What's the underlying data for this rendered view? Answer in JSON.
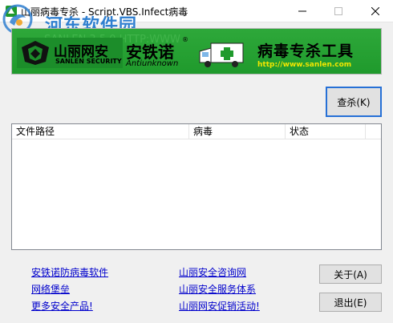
{
  "window": {
    "title": "山丽病毒专杀 - Script.VBS.Infect病毒"
  },
  "watermark": {
    "text": "河东软件园"
  },
  "banner": {
    "ghost_text": "SANLEN 3.5.0 HTTP:WWW",
    "brand_cn": "山丽网安",
    "brand_en": "SANLEN SECURITY",
    "product_cn": "安铁诺",
    "product_reg": "®",
    "product_en": "Antiunknown",
    "tool_cn": "病毒专杀工具",
    "tool_url": "http://www.sanlen.com"
  },
  "buttons": {
    "scan": "查杀(K)",
    "about": "关于(A)",
    "exit": "退出(E)"
  },
  "list": {
    "columns": [
      "文件路径",
      "病毒",
      "状态"
    ],
    "rows": []
  },
  "links": {
    "antivirus_software": "安铁诺防病毒软件",
    "network_fortress": "网络堡垒",
    "more_products": "更多安全产品!",
    "consulting": "山丽安全咨询网",
    "service_system": "山丽安全服务体系",
    "promotion": "山丽网安促销活动!"
  },
  "colors": {
    "banner_green": "#2ea83a",
    "link_blue": "#0000cc",
    "url_yellow": "#f2e600",
    "watermark_blue": "#2f7fd0"
  }
}
